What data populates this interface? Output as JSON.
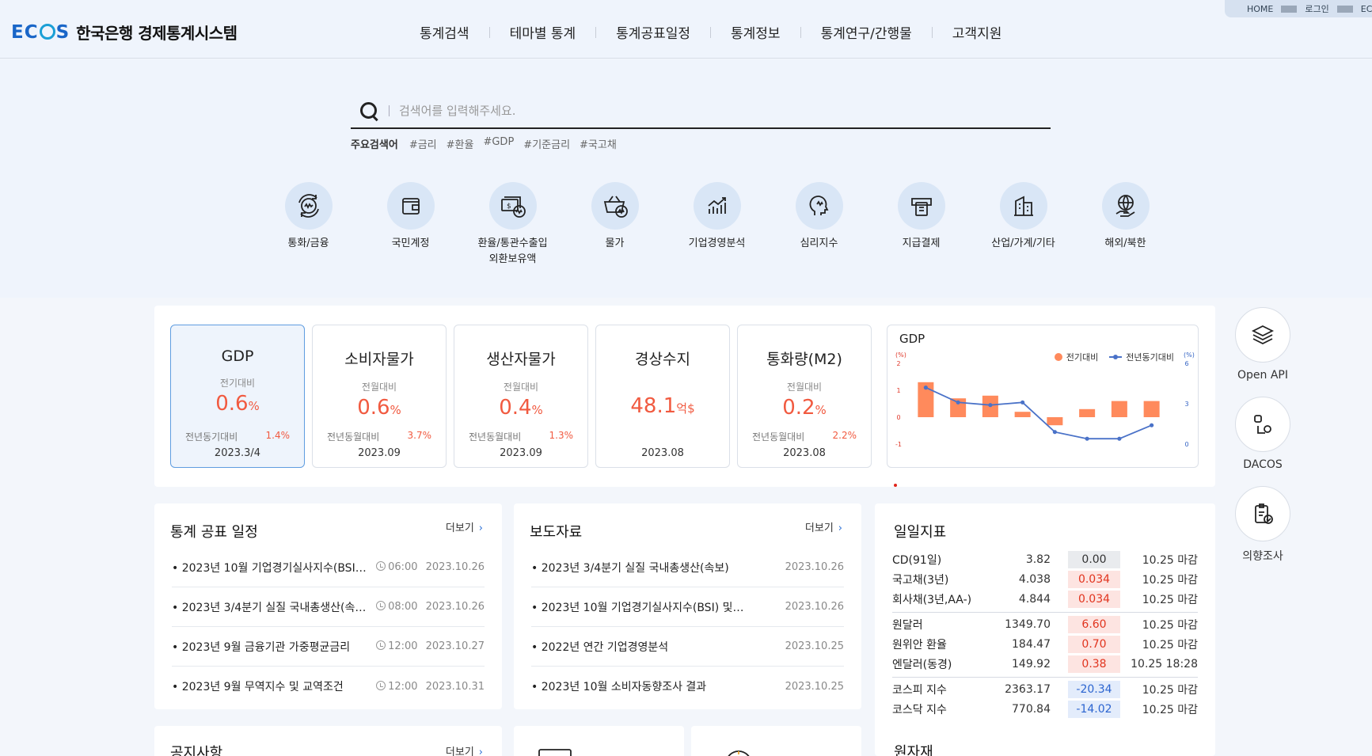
{
  "header": {
    "logo": "ECOS",
    "site_title": "한국은행 경제통계시스템",
    "nav": [
      "통계검색",
      "테마별 통계",
      "통계공표일정",
      "통계정보",
      "통계연구/간행물",
      "고객지원"
    ],
    "util": [
      "HOME",
      "로그인",
      "ECOS 도"
    ]
  },
  "search": {
    "placeholder": "검색어를 입력해주세요.",
    "keywords_label": "주요검색어",
    "keywords": [
      "#금리",
      "#환율",
      "#GDP",
      "#기준금리",
      "#국고채"
    ]
  },
  "categories": [
    "통화/금융",
    "국민계정",
    "환율/통관수출입\n외환보유액",
    "물가",
    "기업경영분석",
    "심리지수",
    "지급결제",
    "산업/가계/기타",
    "해외/북한"
  ],
  "indicators": [
    {
      "title": "GDP",
      "sub": "전기대비",
      "value": "0.6",
      "unit": "%",
      "yoy_label": "전년동기대비",
      "yoy": "1.4%",
      "date": "2023.3/4"
    },
    {
      "title": "소비자물가",
      "sub": "전월대비",
      "value": "0.6",
      "unit": "%",
      "yoy_label": "전년동월대비",
      "yoy": "3.7%",
      "date": "2023.09"
    },
    {
      "title": "생산자물가",
      "sub": "전월대비",
      "value": "0.4",
      "unit": "%",
      "yoy_label": "전년동월대비",
      "yoy": "1.3%",
      "date": "2023.09"
    },
    {
      "title": "경상수지",
      "sub": "",
      "value": "48.1",
      "unit": "억$",
      "yoy_label": "",
      "yoy": "",
      "date": "2023.08"
    },
    {
      "title": "통화량(M2)",
      "sub": "전월대비",
      "value": "0.2",
      "unit": "%",
      "yoy_label": "전년동월대비",
      "yoy": "2.2%",
      "date": "2023.08"
    }
  ],
  "chart_data": {
    "type": "bar",
    "title": "GDP",
    "left_unit": "(%)",
    "right_unit": "(%)",
    "series": [
      {
        "name": "전기대비",
        "type": "bar",
        "axis": "left",
        "values": [
          1.3,
          0.7,
          0.8,
          0.2,
          -0.3,
          0.3,
          0.6,
          0.6
        ]
      },
      {
        "name": "전년동기대비",
        "type": "line",
        "axis": "right",
        "values": [
          4.2,
          3.1,
          2.9,
          3.1,
          0.9,
          0.4,
          0.4,
          1.4
        ]
      }
    ],
    "left_ticks": [
      "2",
      "1",
      "0",
      "-1"
    ],
    "right_ticks": [
      "6",
      "3",
      "0"
    ],
    "ylim_left": [
      -1,
      2
    ],
    "ylim_right": [
      0,
      6
    ]
  },
  "quick_links": [
    "Open API",
    "DACOS",
    "의향조사"
  ],
  "schedule": {
    "title": "통계 공표 일정",
    "more": "더보기",
    "items": [
      {
        "title": "2023년 10월 기업경기실사지수(BSI) 및…",
        "time": "06:00",
        "date": "2023.10.26"
      },
      {
        "title": "2023년 3/4분기 실질 국내총생산(속보)",
        "time": "08:00",
        "date": "2023.10.26"
      },
      {
        "title": "2023년 9월 금융기관 가중평균금리",
        "time": "12:00",
        "date": "2023.10.27"
      },
      {
        "title": "2023년 9월 무역지수 및 교역조건",
        "time": "12:00",
        "date": "2023.10.31"
      }
    ]
  },
  "press": {
    "title": "보도자료",
    "more": "더보기",
    "items": [
      {
        "title": "2023년 3/4분기 실질 국내총생산(속보)",
        "date": "2023.10.26"
      },
      {
        "title": "2023년 10월 기업경기실사지수(BSI) 및…",
        "date": "2023.10.26"
      },
      {
        "title": "2022년 연간 기업경영분석",
        "date": "2023.10.25"
      },
      {
        "title": "2023년 10월 소비자동향조사 결과",
        "date": "2023.10.25"
      }
    ]
  },
  "daily": {
    "title": "일일지표",
    "groups": [
      [
        {
          "name": "CD(91일)",
          "value": "3.82",
          "change": "0.00",
          "dir": "flat",
          "date": "10.25 마감"
        },
        {
          "name": "국고채(3년)",
          "value": "4.038",
          "change": "0.034",
          "dir": "up",
          "date": "10.25 마감"
        },
        {
          "name": "회사채(3년,AA-)",
          "value": "4.844",
          "change": "0.034",
          "dir": "up",
          "date": "10.25 마감"
        }
      ],
      [
        {
          "name": "원달러",
          "value": "1349.70",
          "change": "6.60",
          "dir": "up",
          "date": "10.25 마감"
        },
        {
          "name": "원위안 환율",
          "value": "184.47",
          "change": "0.70",
          "dir": "up",
          "date": "10.25 마감"
        },
        {
          "name": "엔달러(동경)",
          "value": "149.92",
          "change": "0.38",
          "dir": "up",
          "date": "10.25 18:28"
        }
      ],
      [
        {
          "name": "코스피 지수",
          "value": "2363.17",
          "change": "-20.34",
          "dir": "down",
          "date": "10.25 마감"
        },
        {
          "name": "코스닥 지수",
          "value": "770.84",
          "change": "-14.02",
          "dir": "down",
          "date": "10.25 마감"
        }
      ]
    ]
  },
  "notice": {
    "title": "공지사항",
    "more": "더보기"
  },
  "raw": {
    "title": "원자재"
  }
}
